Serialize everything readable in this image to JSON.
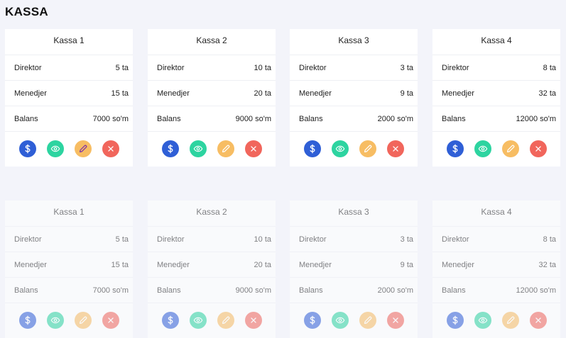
{
  "page": {
    "title": "KASSA"
  },
  "labels": {
    "director": "Direktor",
    "manager": "Menedjer",
    "balance": "Balans"
  },
  "icons": [
    "dollar-icon",
    "eye-icon",
    "pencil-icon",
    "close-icon"
  ],
  "colors": {
    "dollar": "#2f5fd6",
    "view": "#2dd4a0",
    "edit": "#f7bd63",
    "delete": "#f1665c",
    "background": "#f3f4fa"
  },
  "cards": [
    {
      "title": "Kassa 1",
      "director": "5 ta",
      "manager": "15 ta",
      "balance": "7000 so'm"
    },
    {
      "title": "Kassa 2",
      "director": "10 ta",
      "manager": "20 ta",
      "balance": "9000 so'm"
    },
    {
      "title": "Kassa 3",
      "director": "3 ta",
      "manager": "9 ta",
      "balance": "2000 so'm"
    },
    {
      "title": "Kassa 4",
      "director": "8 ta",
      "manager": "32 ta",
      "balance": "12000 so'm"
    },
    {
      "title": "Kassa 1",
      "director": "5 ta",
      "manager": "15 ta",
      "balance": "7000 so'm"
    },
    {
      "title": "Kassa 2",
      "director": "10 ta",
      "manager": "20 ta",
      "balance": "9000 so'm"
    },
    {
      "title": "Kassa 3",
      "director": "3 ta",
      "manager": "9 ta",
      "balance": "2000 so'm"
    },
    {
      "title": "Kassa 4",
      "director": "8 ta",
      "manager": "32 ta",
      "balance": "12000 so'm"
    }
  ]
}
